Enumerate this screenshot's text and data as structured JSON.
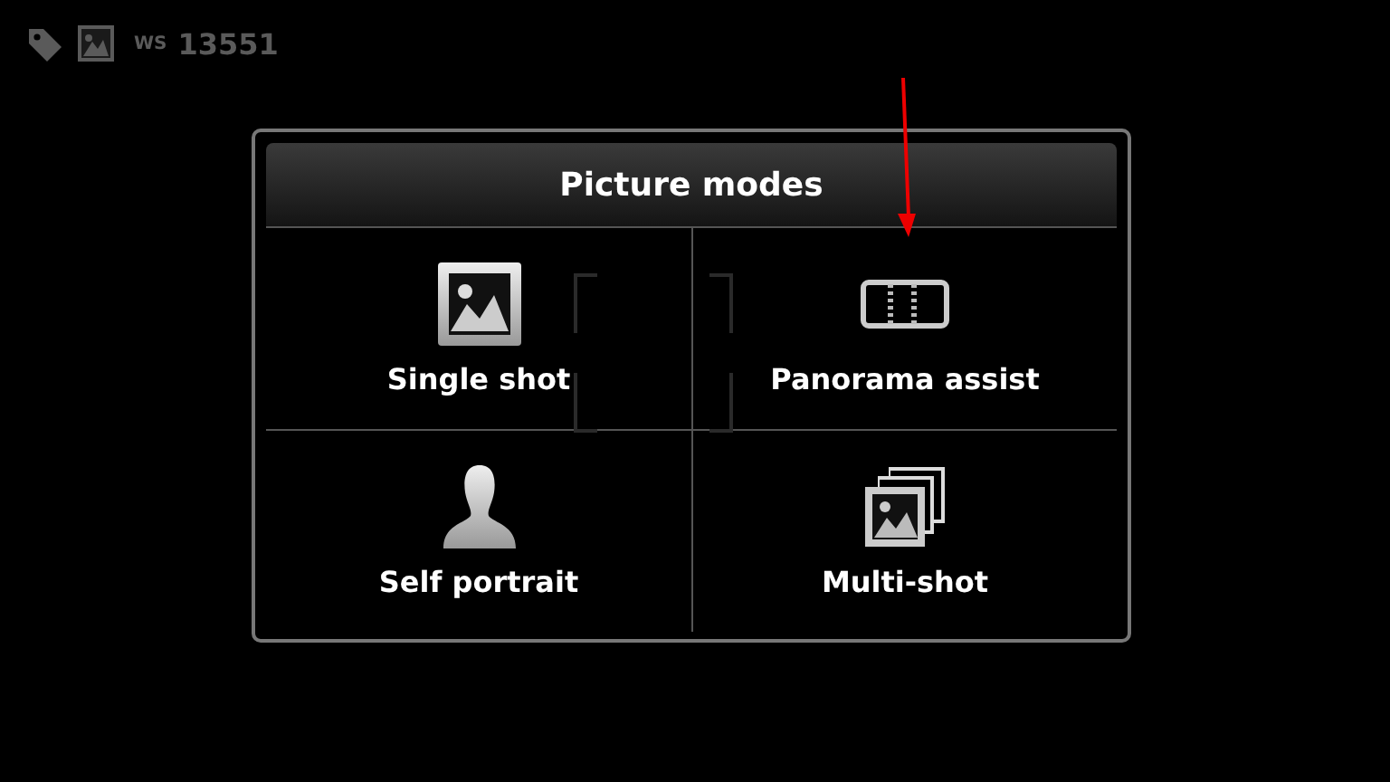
{
  "status_bar": {
    "prefix": "WS",
    "count": "13551"
  },
  "dialog": {
    "title": "Picture modes",
    "modes": [
      {
        "kind": "single",
        "label": "Single shot"
      },
      {
        "kind": "panorama",
        "label": "Panorama assist"
      },
      {
        "kind": "portrait",
        "label": "Self portrait"
      },
      {
        "kind": "multi",
        "label": "Multi-shot"
      }
    ]
  }
}
